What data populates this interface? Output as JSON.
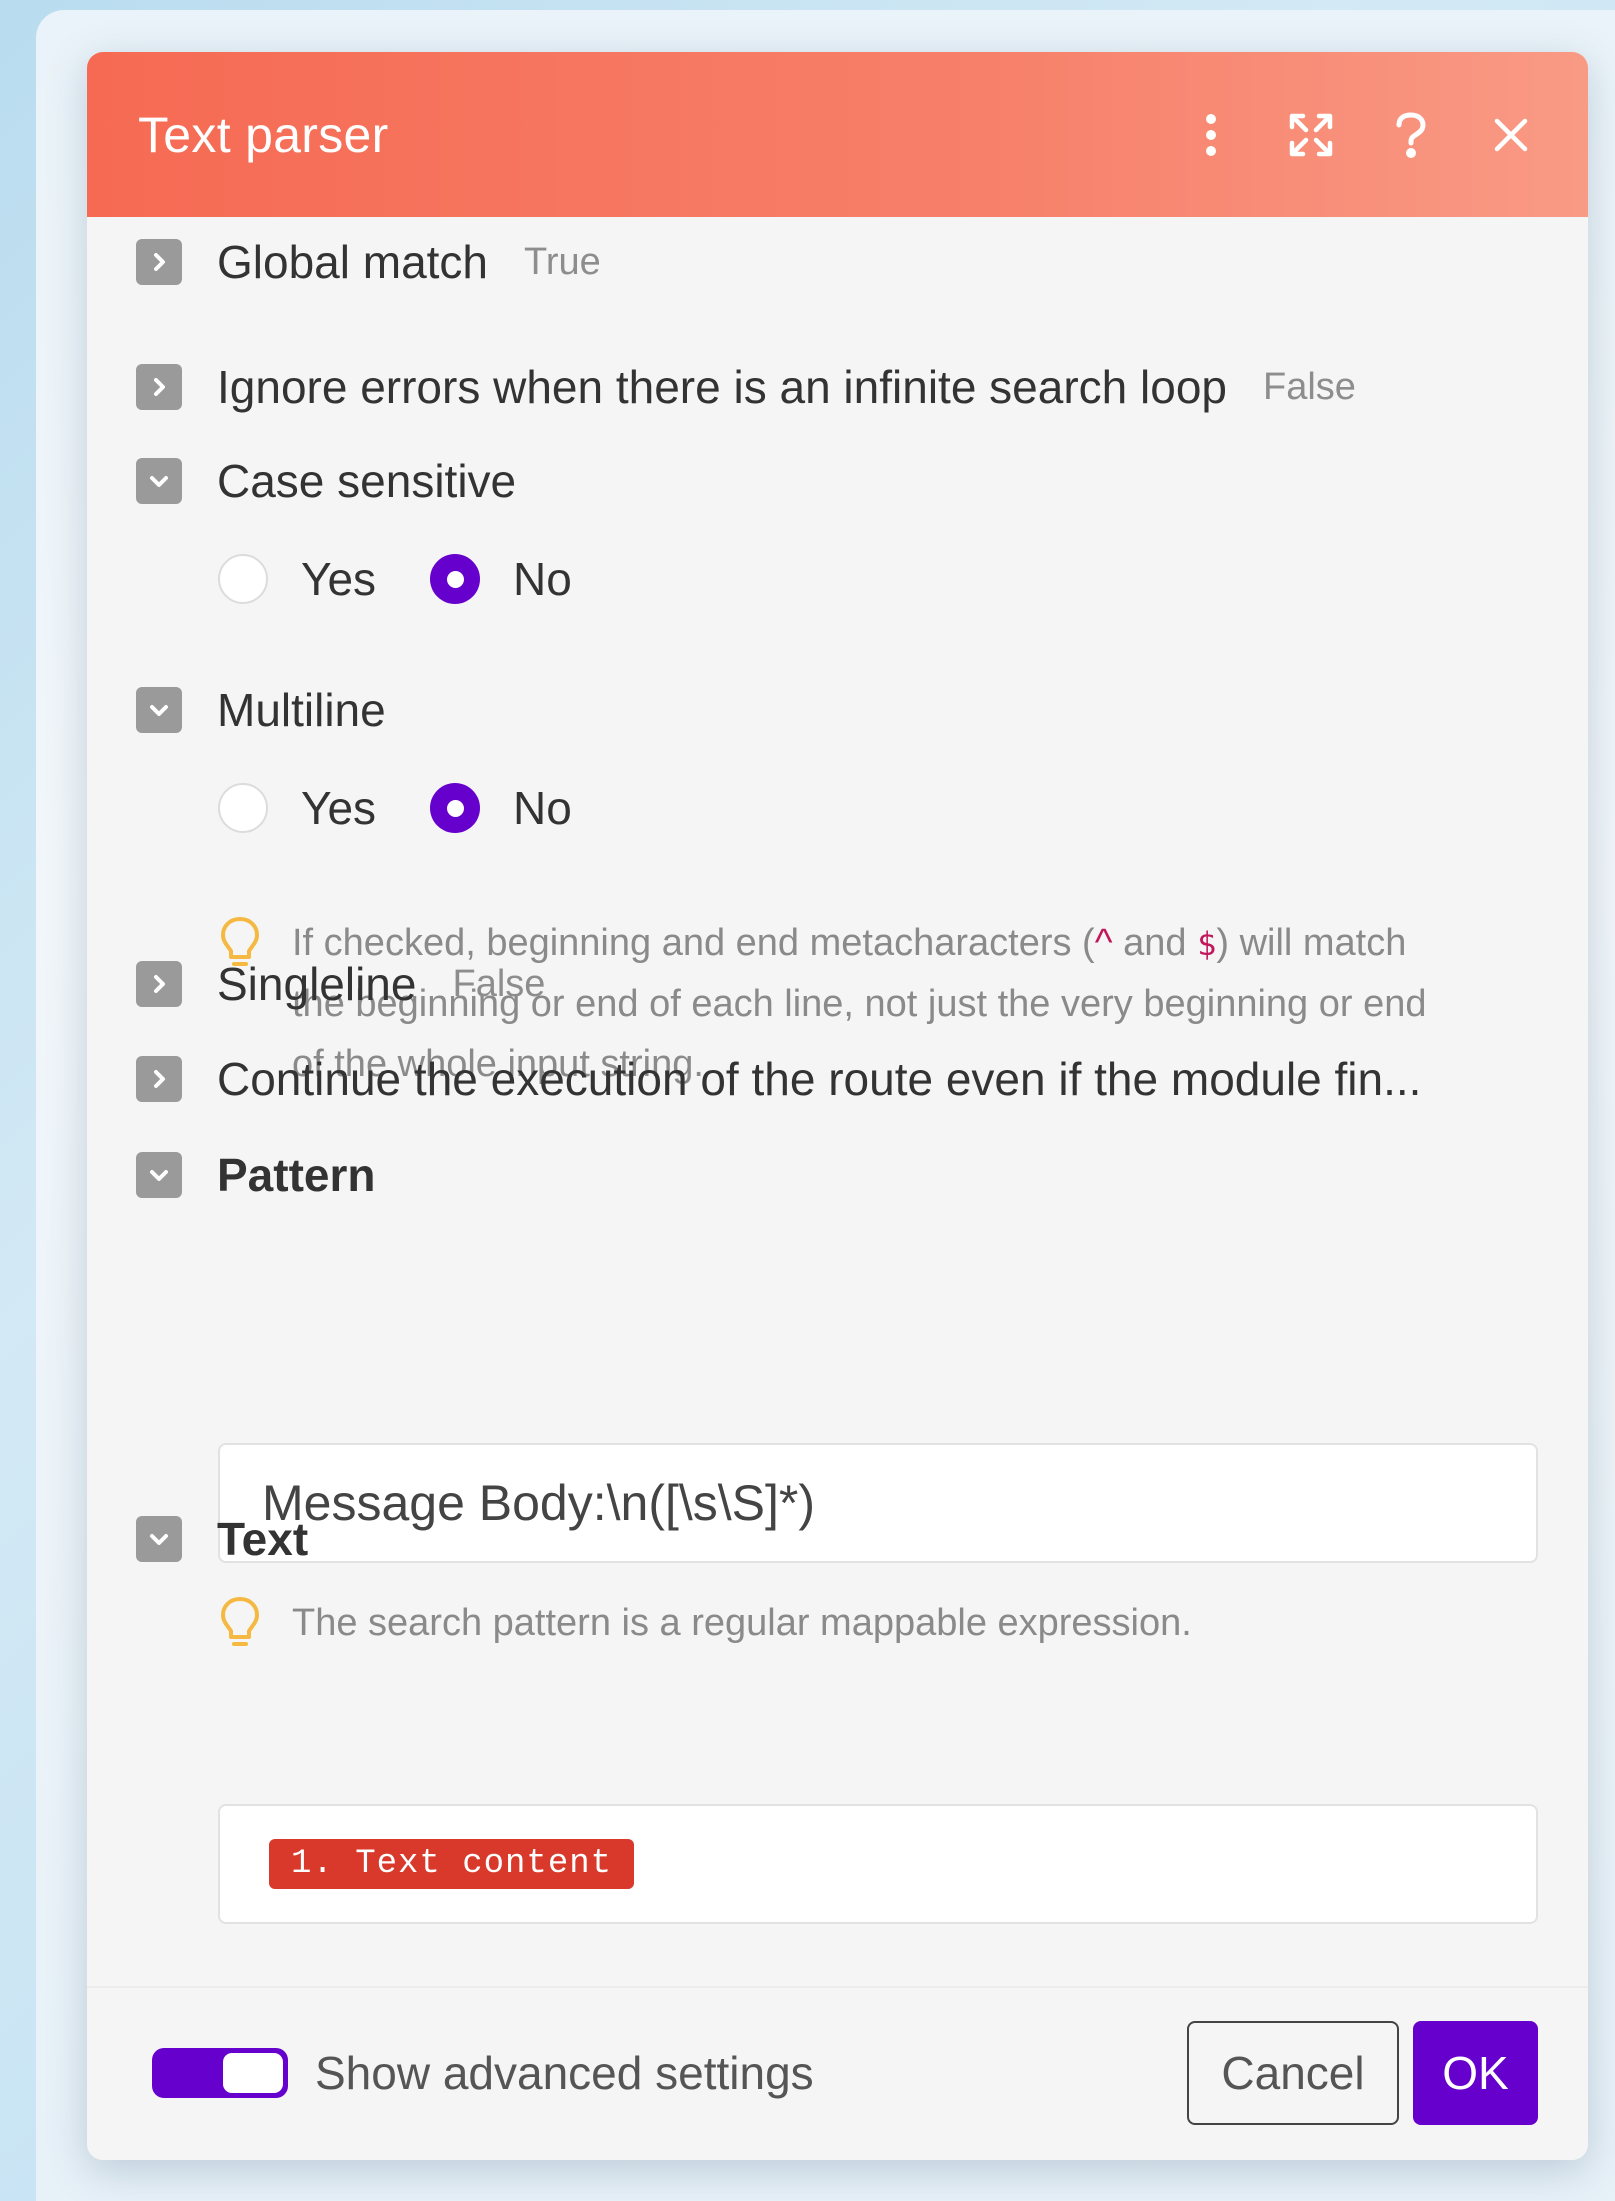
{
  "dialog": {
    "title": "Text parser",
    "header_icons": [
      "more-vertical-icon",
      "expand-icon",
      "help-icon",
      "close-icon"
    ]
  },
  "settings": {
    "global_match": {
      "label": "Global match",
      "value": "True"
    },
    "ignore_errors": {
      "label": "Ignore errors when there is an infinite search loop",
      "value": "False"
    },
    "case_sensitive": {
      "label": "Case sensitive",
      "options": [
        "Yes",
        "No"
      ],
      "selected": "No"
    },
    "multiline": {
      "label": "Multiline",
      "options": [
        "Yes",
        "No"
      ],
      "selected": "No",
      "hint_pre": "If checked, beginning and end metacharacters (",
      "hint_caret": "^",
      "hint_and": " and ",
      "hint_dollar": "$",
      "hint_post": ") will match the beginning or end of each line, not just the very beginning or end of the whole input string."
    },
    "singleline": {
      "label": "Singleline",
      "value": "False"
    },
    "continue_execution": {
      "label": "Continue the execution of the route even if the module fin..."
    },
    "pattern": {
      "label": "Pattern",
      "value": "Message Body:\\n([\\s\\S]*)",
      "hint": "The search pattern is a regular mappable expression."
    },
    "text": {
      "label": "Text",
      "mapped_value": "1. Text content"
    }
  },
  "footer": {
    "advanced_label": "Show advanced settings",
    "advanced_enabled": true,
    "cancel_label": "Cancel",
    "ok_label": "OK"
  },
  "colors": {
    "header": "#f66a53",
    "accent": "#6600cc",
    "mapped_pill": "#d8392b"
  }
}
